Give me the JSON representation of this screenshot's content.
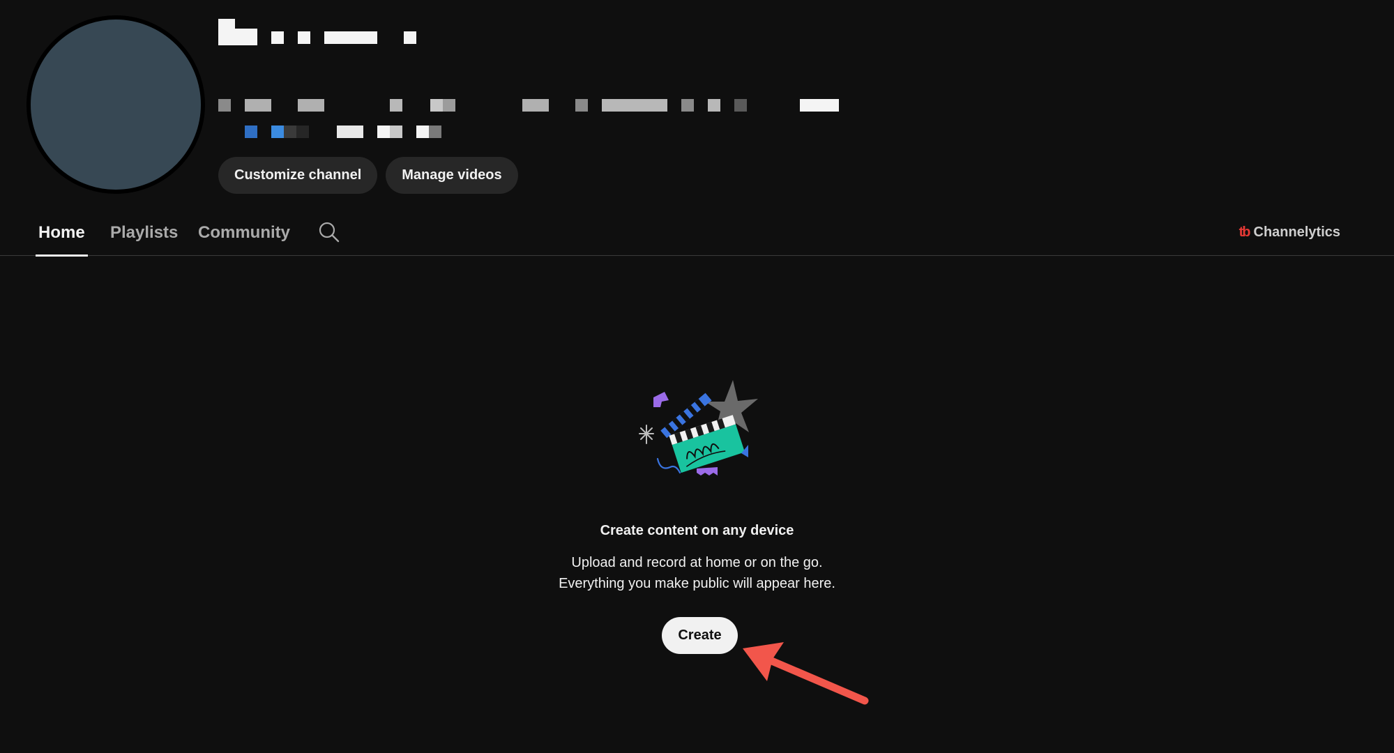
{
  "header": {
    "actions": {
      "customize_label": "Customize channel",
      "manage_label": "Manage videos"
    }
  },
  "tabs": [
    {
      "label": "Home",
      "active": true
    },
    {
      "label": "Playlists",
      "active": false
    },
    {
      "label": "Community",
      "active": false
    }
  ],
  "extension": {
    "logo_text": "tb",
    "label": "Channelytics"
  },
  "empty_state": {
    "title": "Create content on any device",
    "line1": "Upload and record at home or on the go.",
    "line2": "Everything you make public will appear here.",
    "button_label": "Create"
  },
  "icons": {
    "tab_search": "search-icon",
    "extension": "channelytics-logo-icon",
    "illustration": "clapperboard-illustration-icon",
    "annotation": "arrow-annotation-icon"
  },
  "colors": {
    "background": "#0f0f0f",
    "avatar": "#374854",
    "chip_background": "#272727",
    "create_button": "#f1f1f1",
    "extension_brand": "#e53935",
    "annotation_arrow": "#f2564b"
  }
}
